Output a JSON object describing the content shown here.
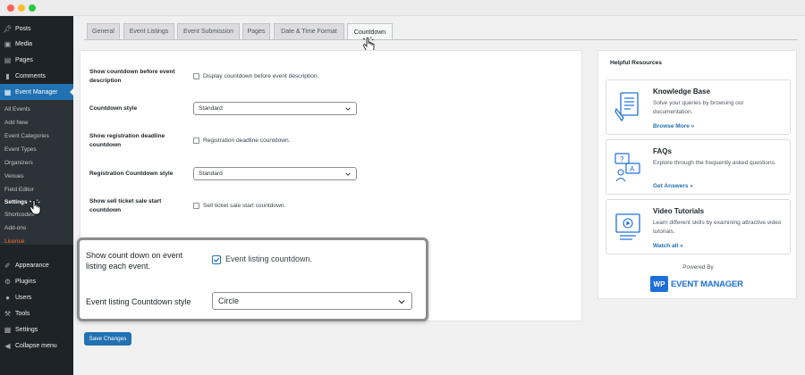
{
  "sidebar": {
    "top_items": [
      {
        "label": "Posts",
        "icon": "pin-icon"
      },
      {
        "label": "Media",
        "icon": "media-icon"
      },
      {
        "label": "Pages",
        "icon": "pages-icon"
      },
      {
        "label": "Comments",
        "icon": "comments-icon"
      },
      {
        "label": "Event Manager",
        "icon": "calendar-icon"
      }
    ],
    "submenu": [
      "All Events",
      "Add New",
      "Event Categories",
      "Event Types",
      "Organizers",
      "Venues",
      "Field Editor",
      "Settings",
      "Shortcodes",
      "Add-ons",
      "License"
    ],
    "bottom_items": [
      {
        "label": "Appearance",
        "icon": "appearance-icon"
      },
      {
        "label": "Plugins",
        "icon": "plugins-icon"
      },
      {
        "label": "Users",
        "icon": "users-icon"
      },
      {
        "label": "Tools",
        "icon": "tools-icon"
      },
      {
        "label": "Settings",
        "icon": "settings-icon"
      },
      {
        "label": "Collapse menu",
        "icon": "collapse-icon"
      }
    ]
  },
  "tabs": [
    "General",
    "Event Listings",
    "Event Submission",
    "Pages",
    "Date & Time Format",
    "Countdown"
  ],
  "settings": {
    "countdown_before_desc": {
      "label": "Show countdown before event description",
      "checkbox_label": "Display countdown before event description."
    },
    "countdown_style": {
      "label": "Countdown style",
      "value": "Standard"
    },
    "registration_deadline": {
      "label": "Show registration deadline countdown",
      "checkbox_label": "Registration deadline countdown."
    },
    "registration_style": {
      "label": "Registration Countdown style",
      "value": "Standard"
    },
    "sell_ticket": {
      "label": "Show sell ticket sale start countdown",
      "checkbox_label": "Sell ticket sale start countdown."
    }
  },
  "callout": {
    "listing_label": "Show count down on event listing each event.",
    "listing_checkbox_label": "Event listing countdown.",
    "listing_checked": true,
    "style_label": "Event listing Countdown style",
    "style_value": "Circle"
  },
  "save_button": "Save Changes",
  "help": {
    "title": "Helpful Resources",
    "cards": [
      {
        "title": "Knowledge Base",
        "desc": "Solve your queries by browsing our documentation.",
        "link": "Browse More »",
        "icon": "document-icon"
      },
      {
        "title": "FAQs",
        "desc": "Explore through the frequently asked questions.",
        "link": "Get Answers »",
        "icon": "faq-icon"
      },
      {
        "title": "Video Tutorials",
        "desc": "Learn different skills by examining attractive video tutorials.",
        "link": "Watch all »",
        "icon": "video-icon"
      }
    ],
    "powered_by": "Powered By",
    "logo_mark": "WP",
    "logo_text": "EVENT MANAGER"
  },
  "colors": {
    "accent": "#2271b1",
    "sidebar_bg": "#1d2327",
    "license": "#f56e28"
  }
}
